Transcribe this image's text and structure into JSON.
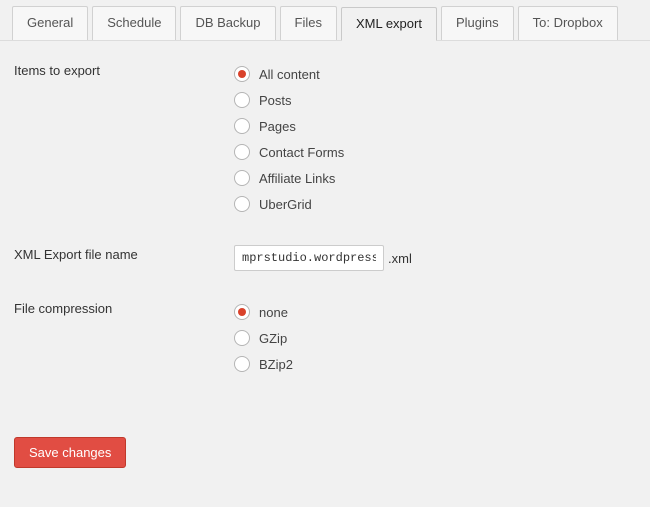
{
  "tabs": [
    {
      "label": "General"
    },
    {
      "label": "Schedule"
    },
    {
      "label": "DB Backup"
    },
    {
      "label": "Files"
    },
    {
      "label": "XML export",
      "active": true
    },
    {
      "label": "Plugins"
    },
    {
      "label": "To: Dropbox"
    }
  ],
  "form": {
    "items_label": "Items to export",
    "items_options": [
      {
        "label": "All content",
        "checked": true
      },
      {
        "label": "Posts",
        "checked": false
      },
      {
        "label": "Pages",
        "checked": false
      },
      {
        "label": "Contact Forms",
        "checked": false
      },
      {
        "label": "Affiliate Links",
        "checked": false
      },
      {
        "label": "UberGrid",
        "checked": false
      }
    ],
    "filename_label": "XML Export file name",
    "filename_value": "mprstudio.wordpress.",
    "filename_suffix": ".xml",
    "compression_label": "File compression",
    "compression_options": [
      {
        "label": "none",
        "checked": true
      },
      {
        "label": "GZip",
        "checked": false
      },
      {
        "label": "BZip2",
        "checked": false
      }
    ]
  },
  "save_label": "Save changes"
}
